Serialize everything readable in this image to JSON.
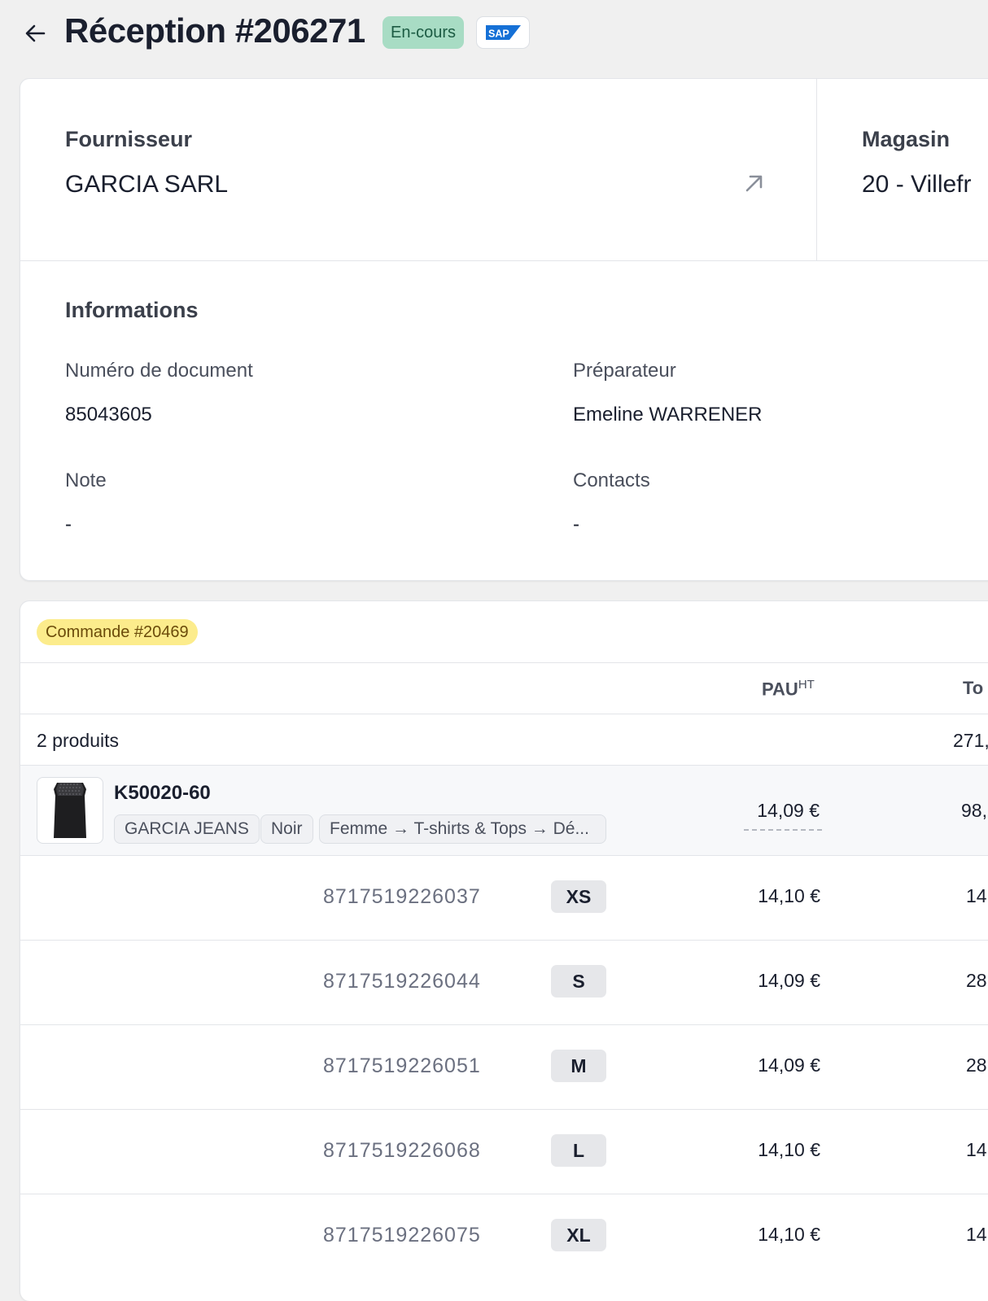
{
  "header": {
    "title": "Réception #206271",
    "status": "En-cours",
    "integration_logo": "SAP"
  },
  "supplier": {
    "label": "Fournisseur",
    "name": "GARCIA SARL"
  },
  "store": {
    "label": "Magasin",
    "name": "20 - Villefr"
  },
  "info": {
    "title": "Informations",
    "doc_number_label": "Numéro de document",
    "doc_number": "85043605",
    "preparer_label": "Préparateur",
    "preparer": "Emeline WARRENER",
    "note_label": "Note",
    "note": "-",
    "contacts_label": "Contacts",
    "contacts": "-"
  },
  "order": {
    "badge": "Commande #20469",
    "columns": {
      "pau": "PAU",
      "pau_suffix": "HT",
      "total": "To"
    },
    "summary_count": "2 produits",
    "summary_total": "271,",
    "product": {
      "sku": "K50020-60",
      "tags": [
        "GARCIA JEANS",
        "Noir",
        "Femme → T-shirts & Tops → Dé..."
      ],
      "pau": "14,09 €",
      "total": "98,"
    },
    "variants": [
      {
        "ean": "8717519226037",
        "size": "XS",
        "price": "14,10 €",
        "total": "14"
      },
      {
        "ean": "8717519226044",
        "size": "S",
        "price": "14,09 €",
        "total": "28"
      },
      {
        "ean": "8717519226051",
        "size": "M",
        "price": "14,09 €",
        "total": "28"
      },
      {
        "ean": "8717519226068",
        "size": "L",
        "price": "14,10 €",
        "total": "14"
      },
      {
        "ean": "8717519226075",
        "size": "XL",
        "price": "14,10 €",
        "total": "14"
      }
    ]
  },
  "colors": {
    "status_bg": "#a8dcc4",
    "order_badge_bg": "#fcec8c",
    "sap_blue": "#1570d6"
  }
}
